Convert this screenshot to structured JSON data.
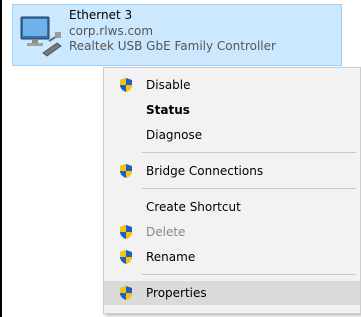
{
  "adapter": {
    "name": "Ethernet 3",
    "domain": "corp.rlws.com",
    "device": "Realtek USB GbE Family Controller",
    "icon": "network-adapter-icon"
  },
  "menu": {
    "disable": "Disable",
    "status": "Status",
    "diagnose": "Diagnose",
    "bridge": "Bridge Connections",
    "shortcut": "Create Shortcut",
    "delete": "Delete",
    "rename": "Rename",
    "properties": "Properties"
  },
  "colors": {
    "selection_bg": "#cce8ff",
    "menu_bg": "#f2f2f2",
    "hover_bg": "#dadada",
    "shield_blue": "#1f5fc4",
    "shield_yellow": "#f6c600"
  }
}
